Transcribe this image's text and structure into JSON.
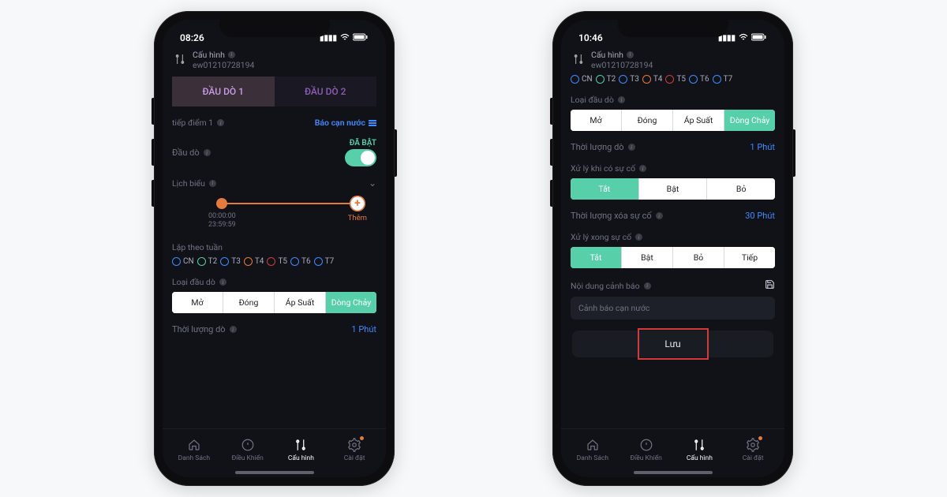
{
  "phone1": {
    "time": "08:26",
    "header": {
      "title": "Cấu hình",
      "device_id": "ew01210728194"
    },
    "tabs": {
      "t1": "ĐẦU DÒ 1",
      "t2": "ĐẦU DÒ 2"
    },
    "contact": {
      "label": "tiếp điểm 1",
      "value": "Báo cạn nước"
    },
    "probe": {
      "label": "Đầu dò",
      "state": "ĐÃ BẬT"
    },
    "schedule": {
      "label": "Lịch biểu",
      "from": "00:00:00",
      "to": "23:59:59",
      "add": "Thêm"
    },
    "weekly": {
      "label": "Lặp theo tuần",
      "days": [
        "CN",
        "T2",
        "T3",
        "T4",
        "T5",
        "T6",
        "T7"
      ]
    },
    "probe_type": {
      "label": "Loại đầu dò",
      "opts": [
        "Mở",
        "Đóng",
        "Áp Suất",
        "Dòng Chảy"
      ],
      "sel": 3
    },
    "duration": {
      "label": "Thời lượng dò",
      "value": "1 Phút"
    },
    "nav": {
      "list": "Danh Sách",
      "ctrl": "Điều Khiển",
      "cfg": "Cấu hình",
      "set": "Cài đặt"
    }
  },
  "phone2": {
    "time": "10:46",
    "header": {
      "title": "Cấu hình",
      "device_id": "ew01210728194"
    },
    "weekly_days": [
      "CN",
      "T2",
      "T3",
      "T4",
      "T5",
      "T6",
      "T7"
    ],
    "probe_type": {
      "label": "Loại đầu dò",
      "opts": [
        "Mở",
        "Đóng",
        "Áp Suất",
        "Dòng Chảy"
      ],
      "sel": 3
    },
    "duration": {
      "label": "Thời lượng dò",
      "value": "1 Phút"
    },
    "on_issue": {
      "label": "Xử lý khi có sự cố",
      "opts": [
        "Tắt",
        "Bật",
        "Bỏ"
      ],
      "sel": 0
    },
    "clear_dur": {
      "label": "Thời lượng xóa sự cố",
      "value": "30 Phút"
    },
    "after_issue": {
      "label": "Xử lý xong sự cố",
      "opts": [
        "Tắt",
        "Bật",
        "Bỏ",
        "Tiếp"
      ],
      "sel": 0
    },
    "alert": {
      "label": "Nội dung cảnh báo",
      "value": "Cảnh báo cạn nước"
    },
    "save": "Lưu",
    "nav": {
      "list": "Danh Sách",
      "ctrl": "Điều Khiển",
      "cfg": "Cấu hình",
      "set": "Cài đặt"
    }
  },
  "day_colors": [
    "#3d8bff",
    "#57cfa9",
    "#3d8bff",
    "#e57a3e",
    "#d23b3b",
    "#3d8bff",
    "#3d8bff"
  ]
}
